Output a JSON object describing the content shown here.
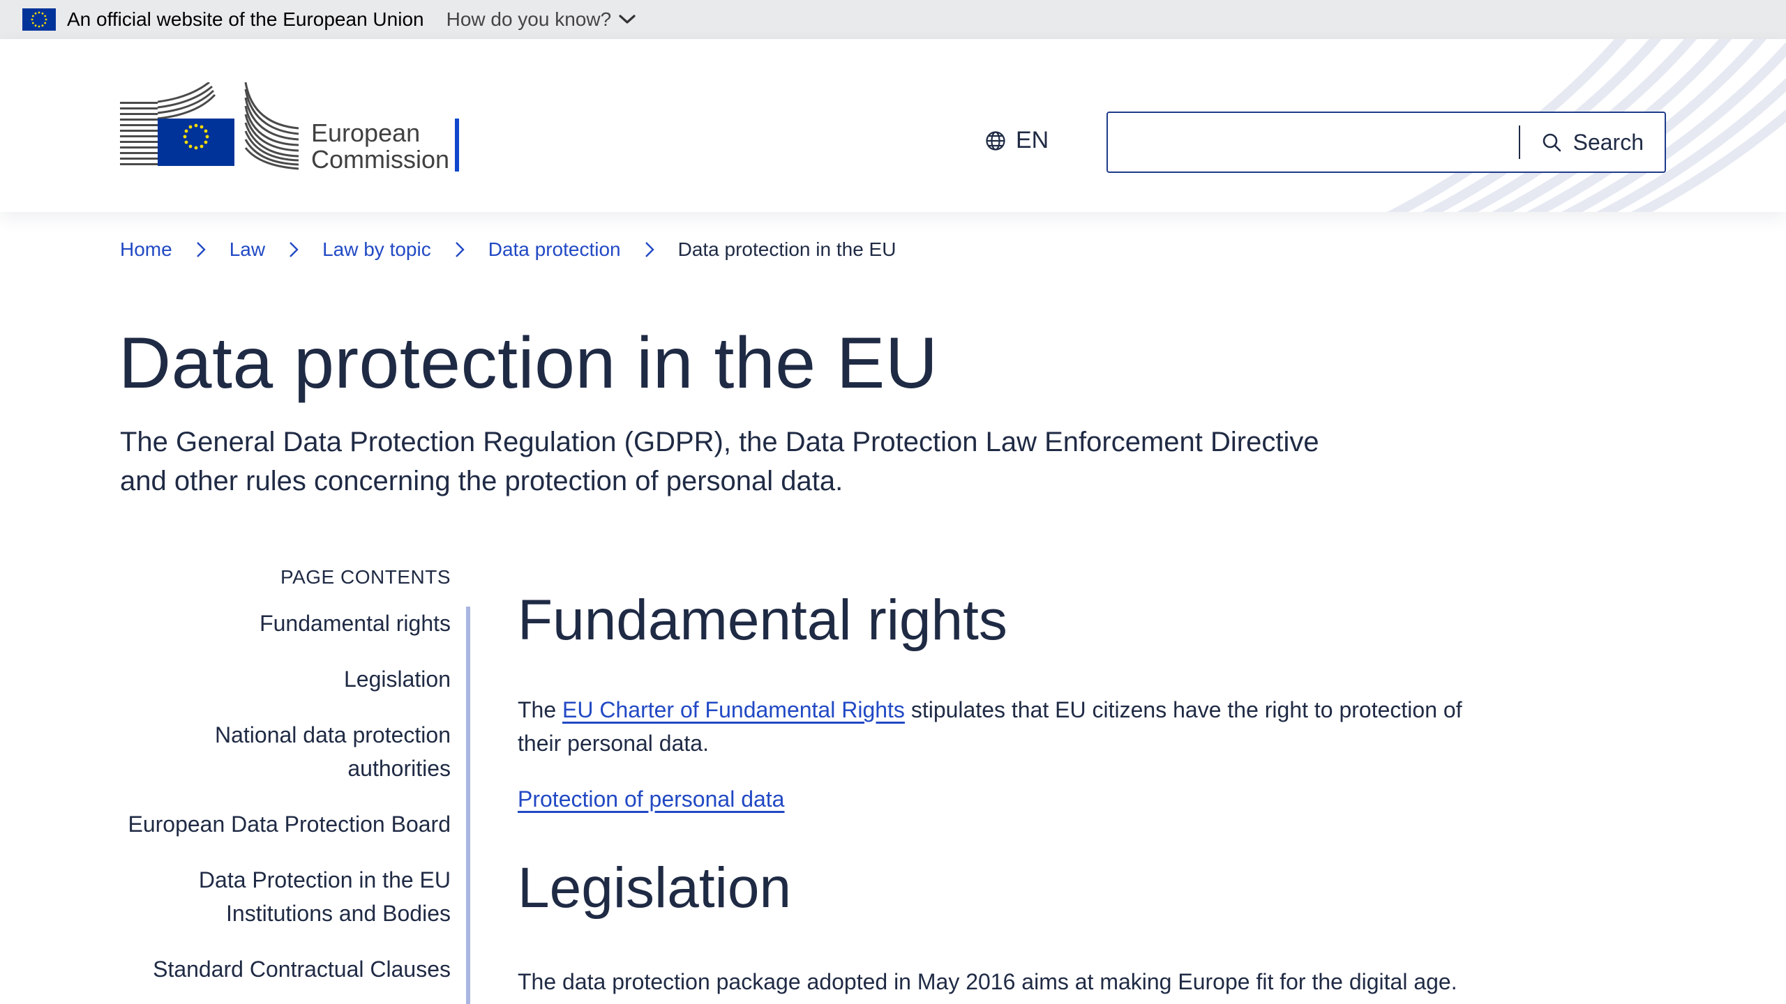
{
  "eu_banner": {
    "text": "An official website of the European Union",
    "how_label": "How do you know?"
  },
  "header": {
    "logo_line1": "European",
    "logo_line2": "Commission",
    "language": "EN",
    "search_placeholder": "",
    "search_label": "Search"
  },
  "breadcrumb": {
    "items": [
      "Home",
      "Law",
      "Law by topic",
      "Data protection"
    ],
    "current": "Data protection in the EU"
  },
  "page": {
    "title": "Data protection in the EU",
    "intro_line1": "The General Data Protection Regulation (GDPR), the Data Protection Law Enforcement Directive",
    "intro_line2": "and other rules concerning the protection of personal data."
  },
  "toc": {
    "heading": "PAGE CONTENTS",
    "items": [
      "Fundamental rights",
      "Legislation",
      "National data protection authorities",
      "European Data Protection Board",
      "Data Protection in the EU Institutions and Bodies",
      "Standard Contractual Clauses"
    ]
  },
  "sections": {
    "fundamental": {
      "heading": "Fundamental rights",
      "text_before": "The ",
      "link": "EU Charter of Fundamental Rights",
      "text_after": " stipulates that EU citizens have the right to protection of their personal data.",
      "related_link": "Protection of personal data"
    },
    "legislation": {
      "heading": "Legislation",
      "text": "The data protection package adopted in May 2016 aims at making Europe fit for the digital age."
    }
  },
  "colors": {
    "eu_blue": "#003399",
    "eu_yellow": "#ffdd00",
    "link": "#2149c4",
    "text": "#1f2a44"
  }
}
